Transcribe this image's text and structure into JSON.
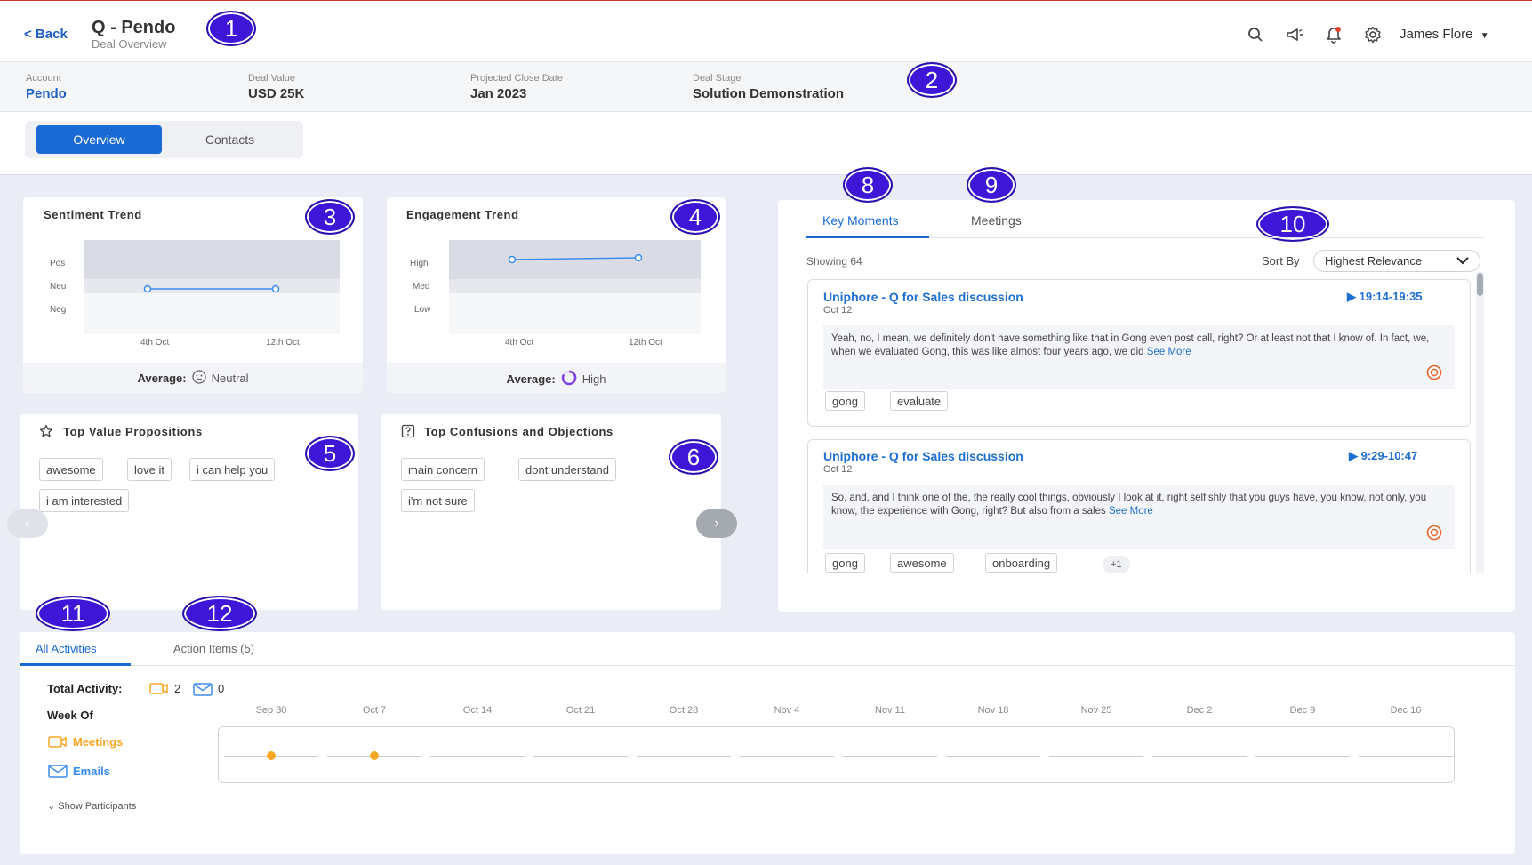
{
  "header": {
    "back_label": "< Back",
    "title": "Q - Pendo",
    "subtitle": "Deal Overview",
    "user_name": "James Flore",
    "icons": [
      "search-icon",
      "megaphone-icon",
      "bell-icon",
      "gear-icon",
      "chevron-down-icon"
    ]
  },
  "deal": {
    "account_label": "Account",
    "account_value": "Pendo",
    "value_label": "Deal Value",
    "value_value": "USD 25K",
    "close_label": "Projected Close Date",
    "close_value": "Jan 2023",
    "stage_label": "Deal Stage",
    "stage_value": "Solution Demonstration"
  },
  "view_tabs": {
    "overview": "Overview",
    "contacts": "Contacts",
    "active": "Overview"
  },
  "badges": [
    "1",
    "2",
    "3",
    "4",
    "5",
    "6",
    "8",
    "9",
    "10",
    "11",
    "12"
  ],
  "sentiment": {
    "title": "Sentiment Trend",
    "y_labels": [
      "Pos",
      "Neu",
      "Neg"
    ],
    "x_labels": [
      "4th Oct",
      "12th Oct"
    ],
    "avg_label": "Average:",
    "avg_value": "Neutral"
  },
  "engagement": {
    "title": "Engagement Trend",
    "y_labels": [
      "High",
      "Med",
      "Low"
    ],
    "x_labels": [
      "4th Oct",
      "12th Oct"
    ],
    "avg_label": "Average:",
    "avg_value": "High"
  },
  "value_props": {
    "title": "Top Value Propositions",
    "tags": [
      "awesome",
      "love it",
      "i can help you",
      "i am interested"
    ]
  },
  "confusions": {
    "title": "Top Confusions and Objections",
    "tags": [
      "main concern",
      "dont understand",
      "i'm not sure"
    ]
  },
  "moments": {
    "tab_key": "Key Moments",
    "tab_meetings": "Meetings",
    "showing": "Showing 64",
    "sort_label": "Sort By",
    "sort_value": "Highest Relevance",
    "items": [
      {
        "title": "Uniphore - Q for Sales discussion",
        "date": "Oct 12",
        "time": "19:14-19:35",
        "quote": "Yeah, no, I mean, we definitely don't have something like that in Gong even post call, right? Or at least not that I know of. In fact, we, when we evaluated Gong, this was like almost four years ago, we did",
        "see_more": "See More",
        "tags": [
          "gong",
          "evaluate"
        ]
      },
      {
        "title": "Uniphore - Q for Sales discussion",
        "date": "Oct 12",
        "time": "9:29-10:47",
        "quote": "So, and, and I think one of the, the really cool things, obviously I look at it, right selfishly that you guys have, you know, not only, you know, the experience with Gong, right? But also from a sales",
        "see_more": "See More",
        "tags": [
          "gong",
          "awesome",
          "onboarding"
        ],
        "more_tags": "+1"
      }
    ]
  },
  "activity": {
    "tab_all": "All Activities",
    "tab_actions": "Action Items (5)",
    "total_label": "Total Activity:",
    "meetings_count": "2",
    "emails_count": "0",
    "week_of": "Week Of",
    "meetings_label": "Meetings",
    "emails_label": "Emails",
    "show_participants": "Show Participants",
    "weeks": [
      "Sep 30",
      "Oct 7",
      "Oct 14",
      "Oct 21",
      "Oct 28",
      "Nov 4",
      "Nov 11",
      "Nov 18",
      "Nov 25",
      "Dec 2",
      "Dec 9",
      "Dec 16"
    ],
    "meeting_weeks": [
      "Sep 30",
      "Oct 7"
    ]
  },
  "colors": {
    "accent": "#1a6ad6",
    "badge": "#3d16d8",
    "meeting": "#f5a623",
    "engagement_ring": "#7b3fe4"
  }
}
